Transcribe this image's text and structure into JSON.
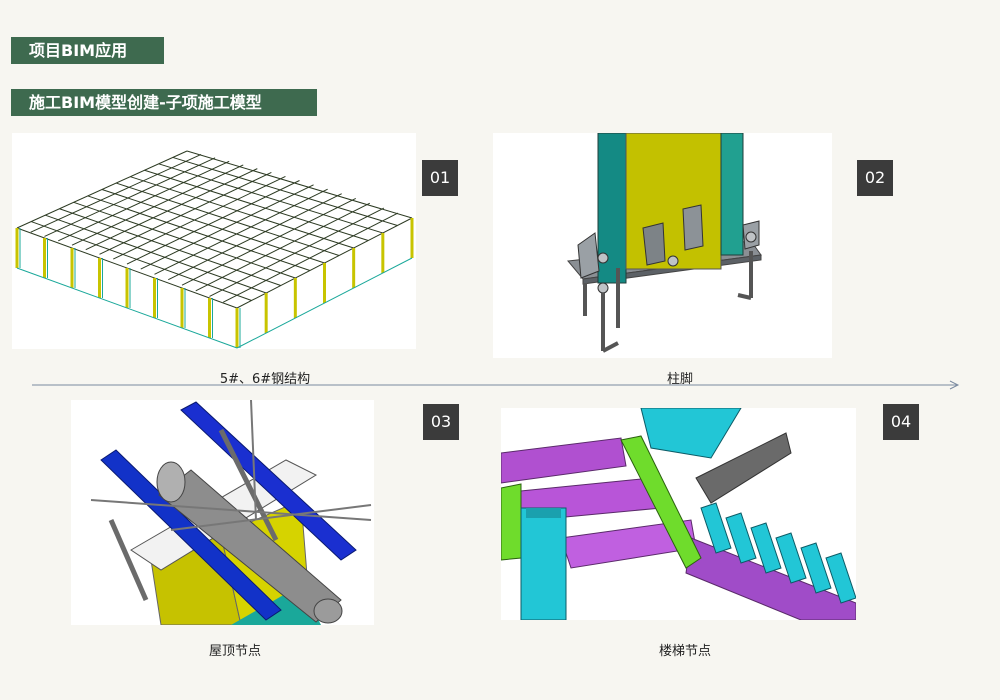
{
  "header": {
    "section_label": "项目BIM应用",
    "subsection_label": "施工BIM模型创建-子项施工模型"
  },
  "figures": [
    {
      "number": "01",
      "caption": "5#、6#钢结构"
    },
    {
      "number": "02",
      "caption": "柱脚"
    },
    {
      "number": "03",
      "caption": "屋顶节点"
    },
    {
      "number": "04",
      "caption": "楼梯节点"
    }
  ],
  "colors": {
    "tag_bg": "#3e6a4f",
    "number_bg": "#3b3b3b",
    "page_bg": "#f7f6f1",
    "steel_yellow": "#c8c400",
    "steel_teal": "#1aa89a",
    "steel_blue": "#1024c8",
    "steel_purple": "#b04fd0",
    "steel_green": "#6fdc2c",
    "steel_cyan": "#22c6d6"
  }
}
